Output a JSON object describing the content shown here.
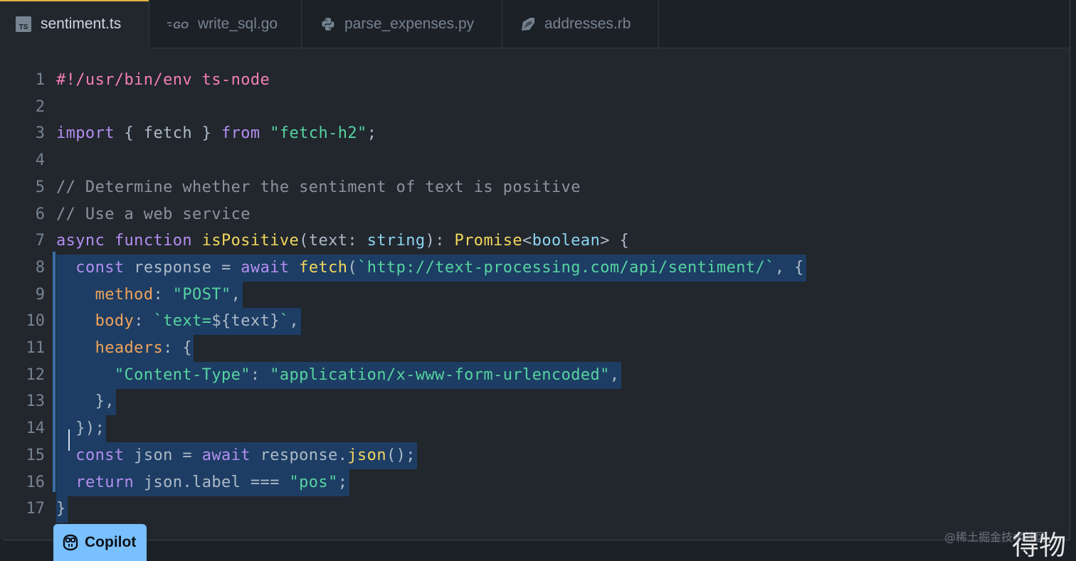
{
  "tabs": [
    {
      "label": "sentiment.ts",
      "icon": "typescript-icon",
      "active": true
    },
    {
      "label": "write_sql.go",
      "icon": "go-icon",
      "active": false
    },
    {
      "label": "parse_expenses.py",
      "icon": "python-icon",
      "active": false
    },
    {
      "label": "addresses.rb",
      "icon": "ruby-icon",
      "active": false
    }
  ],
  "tab_icon_text": {
    "ts": "TS",
    "go": "GO"
  },
  "editor": {
    "lines": [
      {
        "n": "1",
        "tokens": [
          {
            "t": "#!/usr/bin/env ts-node",
            "c": "pink"
          }
        ]
      },
      {
        "n": "2",
        "tokens": []
      },
      {
        "n": "3",
        "tokens": [
          {
            "t": "import",
            "c": "kw"
          },
          {
            "t": " { fetch } ",
            "c": "plain"
          },
          {
            "t": "from",
            "c": "kw"
          },
          {
            "t": " ",
            "c": "plain"
          },
          {
            "t": "\"fetch-h2\"",
            "c": "str"
          },
          {
            "t": ";",
            "c": "plain"
          }
        ]
      },
      {
        "n": "4",
        "tokens": []
      },
      {
        "n": "5",
        "tokens": [
          {
            "t": "// Determine whether the sentiment of text is positive",
            "c": "com"
          }
        ]
      },
      {
        "n": "6",
        "tokens": [
          {
            "t": "// Use a web service",
            "c": "com"
          }
        ]
      },
      {
        "n": "7",
        "tokens": [
          {
            "t": "async",
            "c": "kw"
          },
          {
            "t": " ",
            "c": "plain"
          },
          {
            "t": "function",
            "c": "kw"
          },
          {
            "t": " ",
            "c": "plain"
          },
          {
            "t": "isPositive",
            "c": "fn"
          },
          {
            "t": "(text: ",
            "c": "plain"
          },
          {
            "t": "string",
            "c": "type"
          },
          {
            "t": "): ",
            "c": "plain"
          },
          {
            "t": "Promise",
            "c": "fn"
          },
          {
            "t": "<",
            "c": "plain"
          },
          {
            "t": "boolean",
            "c": "type"
          },
          {
            "t": "> {",
            "c": "plain"
          }
        ]
      },
      {
        "n": "8",
        "sel": true,
        "tokens": [
          {
            "t": "  ",
            "c": "plain"
          },
          {
            "t": "const",
            "c": "kw"
          },
          {
            "t": " response = ",
            "c": "plain"
          },
          {
            "t": "await",
            "c": "kw"
          },
          {
            "t": " ",
            "c": "plain"
          },
          {
            "t": "fetch",
            "c": "fn"
          },
          {
            "t": "(",
            "c": "plain"
          },
          {
            "t": "`http://text-processing.com/api/sentiment/`",
            "c": "str"
          },
          {
            "t": ", {",
            "c": "plain"
          }
        ]
      },
      {
        "n": "9",
        "sel": true,
        "tokens": [
          {
            "t": "    ",
            "c": "plain"
          },
          {
            "t": "method",
            "c": "prop"
          },
          {
            "t": ": ",
            "c": "plain"
          },
          {
            "t": "\"POST\"",
            "c": "str"
          },
          {
            "t": ",",
            "c": "plain"
          }
        ]
      },
      {
        "n": "10",
        "sel": true,
        "tokens": [
          {
            "t": "    ",
            "c": "plain"
          },
          {
            "t": "body",
            "c": "prop"
          },
          {
            "t": ": ",
            "c": "plain"
          },
          {
            "t": "`text=",
            "c": "str"
          },
          {
            "t": "${text}",
            "c": "plain"
          },
          {
            "t": "`",
            "c": "str"
          },
          {
            "t": ",",
            "c": "plain"
          }
        ]
      },
      {
        "n": "11",
        "sel": true,
        "tokens": [
          {
            "t": "    ",
            "c": "plain"
          },
          {
            "t": "headers",
            "c": "prop"
          },
          {
            "t": ": {",
            "c": "plain"
          }
        ]
      },
      {
        "n": "12",
        "sel": true,
        "tokens": [
          {
            "t": "      ",
            "c": "plain"
          },
          {
            "t": "\"Content-Type\"",
            "c": "str"
          },
          {
            "t": ": ",
            "c": "plain"
          },
          {
            "t": "\"application/x-www-form-urlencoded\"",
            "c": "str"
          },
          {
            "t": ",",
            "c": "plain"
          }
        ]
      },
      {
        "n": "13",
        "sel": true,
        "tokens": [
          {
            "t": "    },",
            "c": "plain"
          }
        ]
      },
      {
        "n": "14",
        "sel": true,
        "tokens": [
          {
            "t": "  });",
            "c": "plain"
          }
        ]
      },
      {
        "n": "15",
        "sel": true,
        "tokens": [
          {
            "t": "  ",
            "c": "plain"
          },
          {
            "t": "const",
            "c": "kw"
          },
          {
            "t": " json = ",
            "c": "plain"
          },
          {
            "t": "await",
            "c": "kw"
          },
          {
            "t": " response.",
            "c": "plain"
          },
          {
            "t": "json",
            "c": "fn"
          },
          {
            "t": "();",
            "c": "plain"
          }
        ]
      },
      {
        "n": "16",
        "sel": true,
        "tokens": [
          {
            "t": "  ",
            "c": "plain"
          },
          {
            "t": "return",
            "c": "kw"
          },
          {
            "t": " json.label === ",
            "c": "plain"
          },
          {
            "t": "\"pos\"",
            "c": "str"
          },
          {
            "t": ";",
            "c": "plain"
          }
        ]
      },
      {
        "n": "17",
        "sel": true,
        "tokens": [
          {
            "t": "}",
            "c": "plain"
          }
        ]
      }
    ]
  },
  "copilot": {
    "label": "Copilot"
  },
  "watermark": {
    "small": "@稀土掘金技术社区",
    "big": "得物"
  },
  "colors": {
    "accent_tab": "#e3b341",
    "selection": "#1d3d64",
    "copilot_bg": "#79c0ff"
  }
}
